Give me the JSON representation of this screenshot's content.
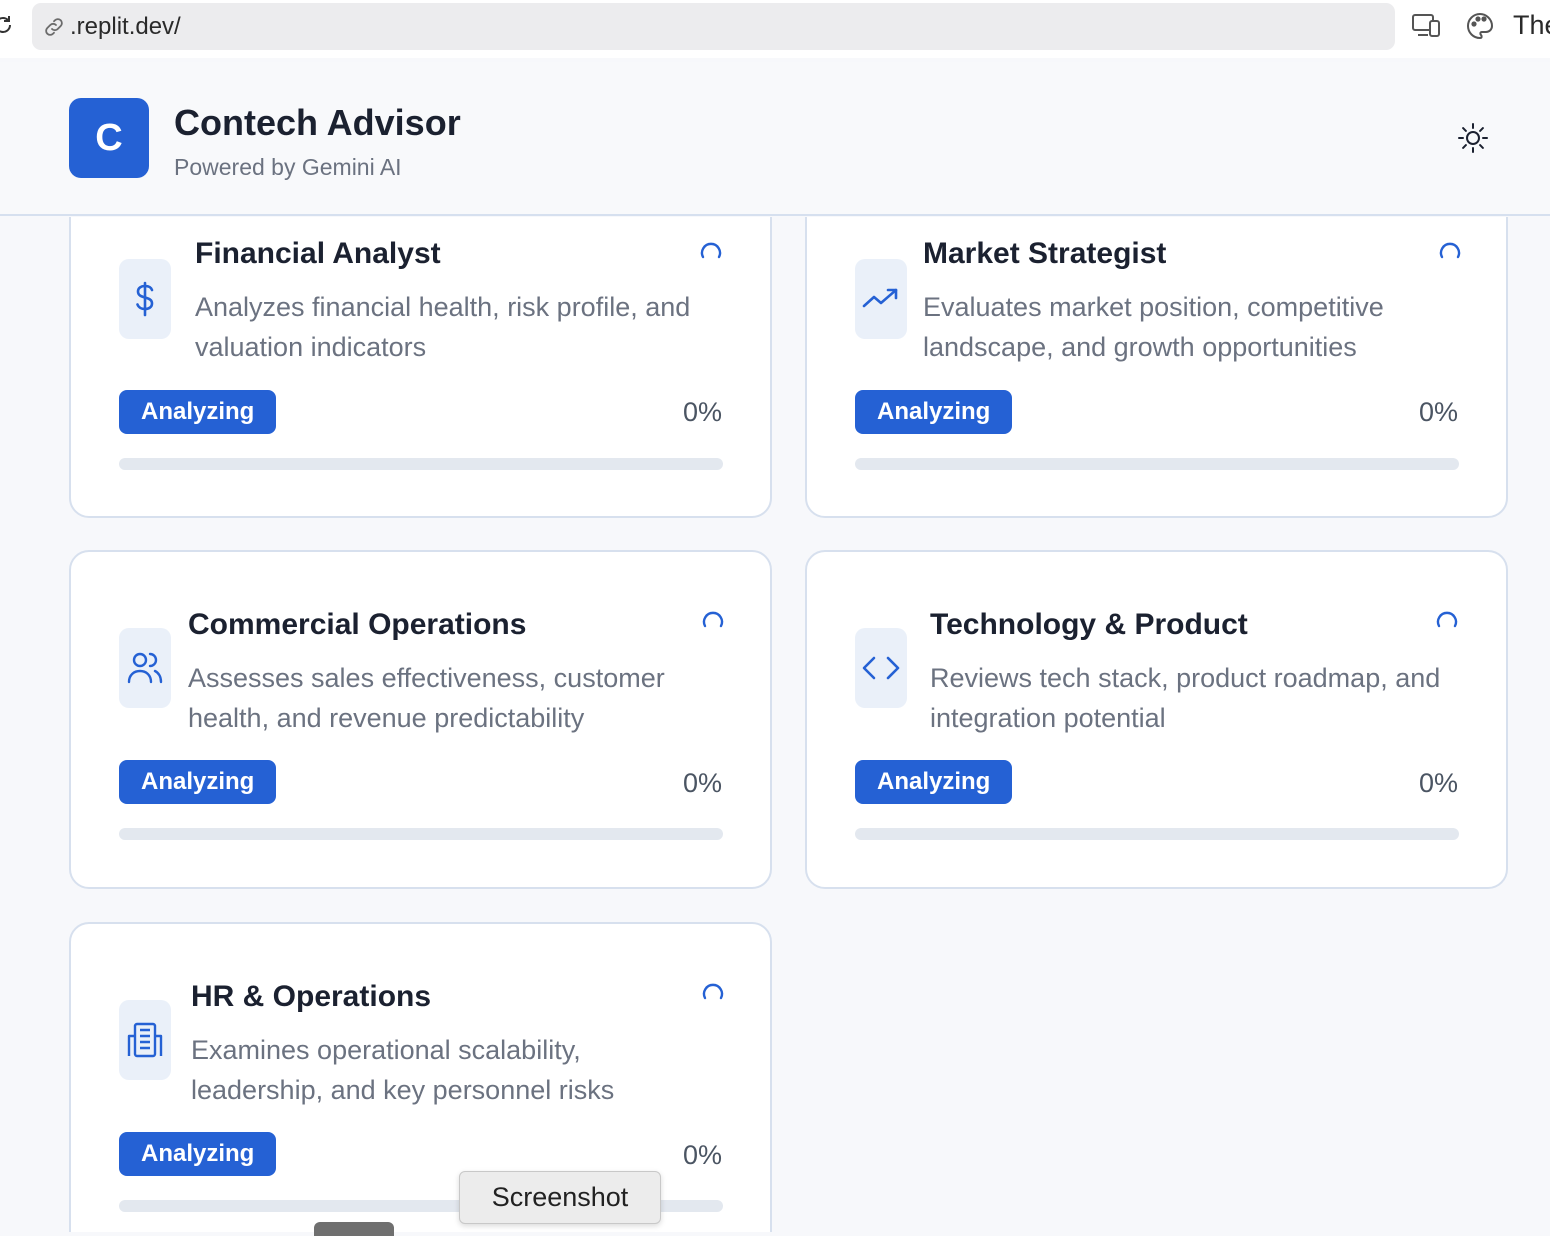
{
  "browser": {
    "url": ".replit.dev/",
    "right_text": "The"
  },
  "header": {
    "logo_letter": "C",
    "title": "Contech Advisor",
    "subtitle": "Powered by Gemini AI",
    "theme_icon": "sun-icon"
  },
  "agents": [
    {
      "title": "Financial Analyst",
      "description": "Analyzes financial health, risk profile, and valuation indicators",
      "icon": "dollar-icon",
      "status": "Analyzing",
      "progress_label": "0%",
      "progress": 0
    },
    {
      "title": "Market Strategist",
      "description": "Evaluates market position, competitive landscape, and growth opportunities",
      "icon": "trending-up-icon",
      "status": "Analyzing",
      "progress_label": "0%",
      "progress": 0
    },
    {
      "title": "Commercial Operations",
      "description": "Assesses sales effectiveness, customer health, and revenue predictability",
      "icon": "users-icon",
      "status": "Analyzing",
      "progress_label": "0%",
      "progress": 0
    },
    {
      "title": "Technology & Product",
      "description": "Reviews tech stack, product roadmap, and integration potential",
      "icon": "code-icon",
      "status": "Analyzing",
      "progress_label": "0%",
      "progress": 0
    },
    {
      "title": "HR & Operations",
      "description": "Examines operational scalability, leadership, and key personnel risks",
      "icon": "building-icon",
      "status": "Analyzing",
      "progress_label": "0%",
      "progress": 0
    }
  ],
  "tooltip": {
    "label": "Screenshot"
  },
  "colors": {
    "accent": "#2561d4",
    "background": "#f7f8fb",
    "track": "#e3e8ef"
  }
}
